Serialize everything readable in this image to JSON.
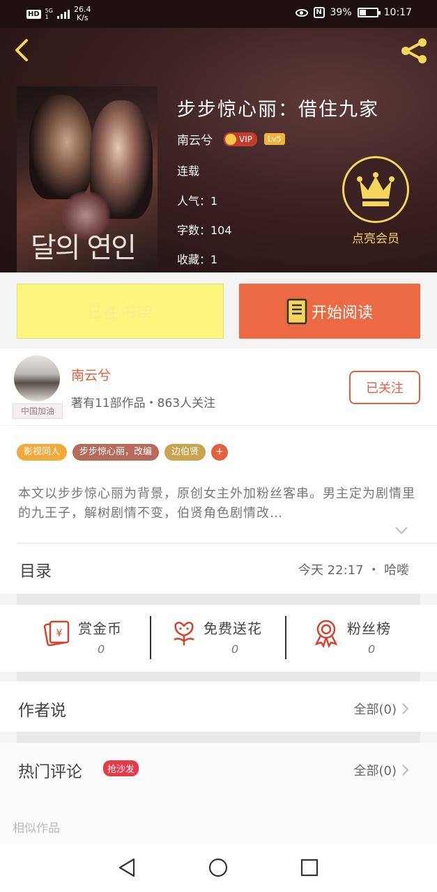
{
  "status_bar": {
    "hd": "HD",
    "network": "5G",
    "signal_sub": "1",
    "speed": "26.4",
    "speed_unit": "K/s",
    "nfc": "N",
    "battery": "39%",
    "battery_level": 0.39,
    "time": "10:17"
  },
  "book": {
    "title": "步步惊心丽：借住九家",
    "author": "南云兮",
    "vip": "VIP",
    "level": "Lv5",
    "status": "连载",
    "popularity": "人气：1",
    "word_count": "字数：104",
    "favorites": "收藏：1",
    "cover_text": "달의 연인",
    "member_label": "点亮会员"
  },
  "actions": {
    "shelf": "已在书架",
    "read": "开始阅读"
  },
  "author_card": {
    "name": "南云兮",
    "works": "著有11部作品・863人关注",
    "avatar_caption": "中国加油",
    "follow": "已关注"
  },
  "tags": [
    {
      "label": "影视同人",
      "color": "#f2a93b"
    },
    {
      "label": "步步惊心丽，改编",
      "color": "#b86a5a"
    },
    {
      "label": "边伯贤",
      "color": "#c9a34e"
    }
  ],
  "tag_add": "+",
  "synopsis": "本文以步步惊心丽为背景，原创女主外加粉丝客串。男主定为剧情里的九王子，解树剧情不变，伯贤角色剧情改…",
  "catalog": {
    "title": "目录",
    "update": "今天 22:17 ・ 哈喽"
  },
  "stats": [
    {
      "label": "赏金币",
      "value": "0",
      "icon": "red-envelope-icon"
    },
    {
      "label": "免费送花",
      "value": "0",
      "icon": "flower-icon"
    },
    {
      "label": "粉丝榜",
      "value": "0",
      "icon": "medal-icon"
    }
  ],
  "author_says": {
    "title": "作者说",
    "all": "全部(0)"
  },
  "hot_comments": {
    "title": "热门评论",
    "badge": "抢沙发",
    "all": "全部(0)"
  },
  "similar": "相似作品",
  "colors": {
    "accent": "#eb6a43",
    "shelf_bg": "#fdf57e",
    "gold": "#f4d65a"
  }
}
